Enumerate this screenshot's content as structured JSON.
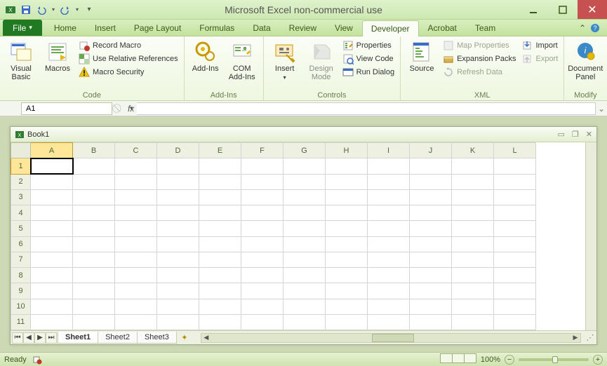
{
  "app_title": "Microsoft Excel non-commercial use",
  "qat": {
    "dd_glyph": "▾"
  },
  "tabs": {
    "file": "File",
    "items": [
      "Home",
      "Insert",
      "Page Layout",
      "Formulas",
      "Data",
      "Review",
      "View",
      "Developer",
      "Acrobat",
      "Team"
    ],
    "active": "Developer"
  },
  "ribbon": {
    "code": {
      "label": "Code",
      "visual_basic": "Visual\nBasic",
      "macros": "Macros",
      "record_macro": "Record Macro",
      "use_relative": "Use Relative References",
      "macro_security": "Macro Security"
    },
    "addins": {
      "label": "Add-Ins",
      "addins": "Add-Ins",
      "com": "COM\nAdd-Ins"
    },
    "controls": {
      "label": "Controls",
      "insert": "Insert",
      "design": "Design\nMode",
      "properties": "Properties",
      "view_code": "View Code",
      "run_dialog": "Run Dialog"
    },
    "xml": {
      "label": "XML",
      "source": "Source",
      "map_properties": "Map Properties",
      "expansion_packs": "Expansion Packs",
      "refresh_data": "Refresh Data",
      "import": "Import",
      "export": "Export"
    },
    "modify": {
      "label": "Modify",
      "doc_panel": "Document\nPanel"
    }
  },
  "namebox": {
    "value": "A1"
  },
  "formula_bar": {
    "fx": "fx",
    "value": ""
  },
  "workbook": {
    "title": "Book1",
    "columns": [
      "A",
      "B",
      "C",
      "D",
      "E",
      "F",
      "G",
      "H",
      "I",
      "J",
      "K",
      "L"
    ],
    "rows": [
      1,
      2,
      3,
      4,
      5,
      6,
      7,
      8,
      9,
      10,
      11
    ],
    "selected": {
      "col": "A",
      "row": 1
    },
    "sheets": [
      "Sheet1",
      "Sheet2",
      "Sheet3"
    ],
    "active_sheet": "Sheet1"
  },
  "status": {
    "ready": "Ready",
    "zoom": "100%"
  }
}
